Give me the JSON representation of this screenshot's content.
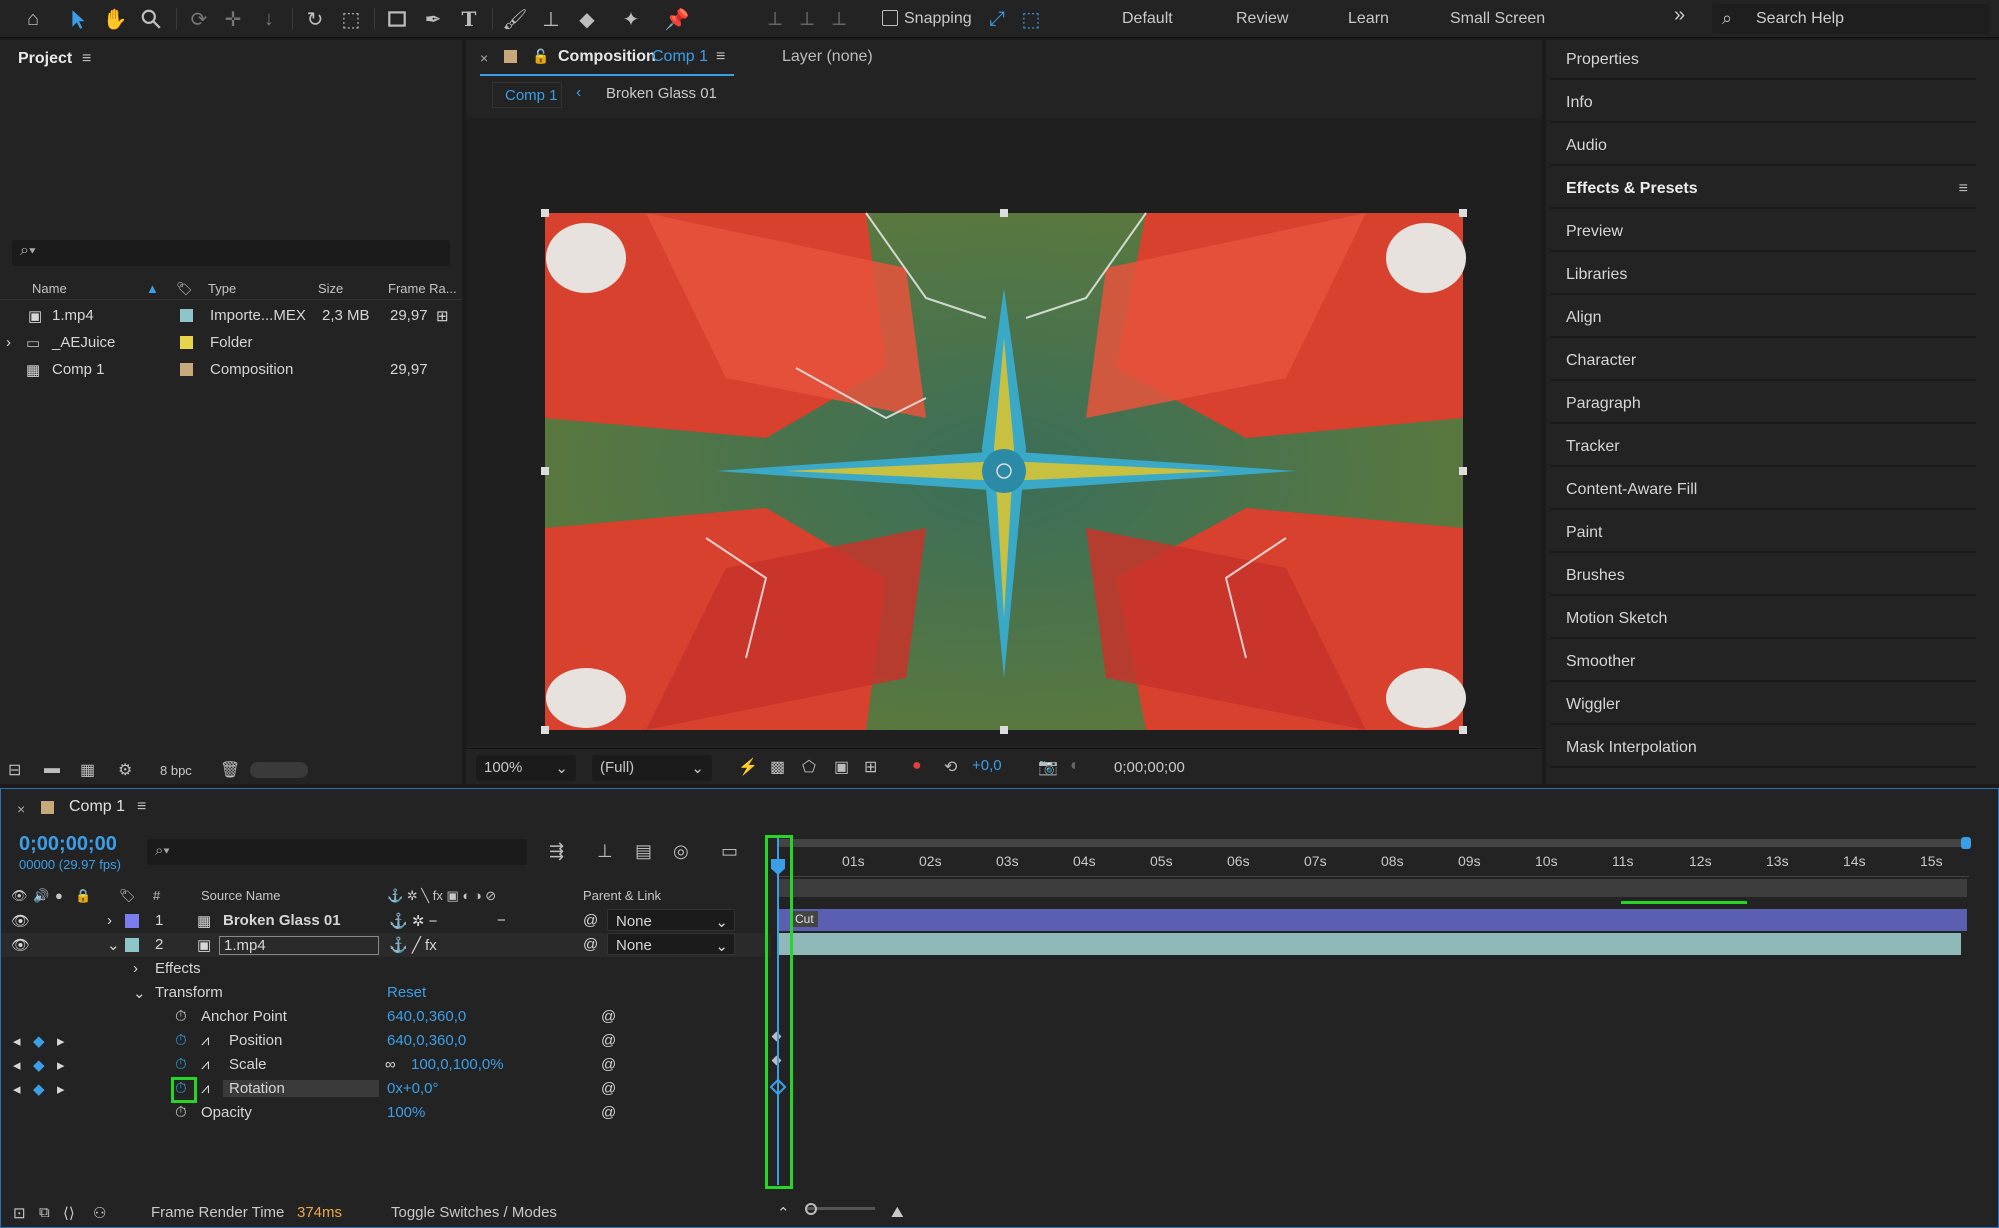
{
  "toolbar": {
    "snapping_label": "Snapping",
    "workspaces": [
      "Default",
      "Review",
      "Learn",
      "Small Screen"
    ],
    "overflow": "»",
    "search_placeholder": "Search Help"
  },
  "project": {
    "title": "Project",
    "columns": {
      "name": "Name",
      "type": "Type",
      "size": "Size",
      "frame_rate": "Frame Ra..."
    },
    "items": [
      {
        "name": "1.mp4",
        "type": "Importe...MEX",
        "size": "2,3 MB",
        "frame_rate": "29,97",
        "color": "#8ec5c9"
      },
      {
        "name": "_AEJuice",
        "type": "Folder",
        "size": "",
        "frame_rate": "",
        "color": "#e8d44a"
      },
      {
        "name": "Comp 1",
        "type": "Composition",
        "size": "",
        "frame_rate": "29,97",
        "color": "#c9a97c"
      }
    ],
    "bit_depth": "8 bpc"
  },
  "composition": {
    "tab_label": "Composition",
    "tab_name": "Comp 1",
    "layer_label": "Layer (none)",
    "breadcrumb_current": "Comp 1",
    "breadcrumb_next": "Broken Glass 01",
    "zoom": "100%",
    "resolution": "(Full)",
    "exposure": "+0,0",
    "timecode": "0;00;00;00"
  },
  "right_panel": {
    "items": [
      "Properties",
      "Info",
      "Audio",
      "Effects & Presets",
      "Preview",
      "Libraries",
      "Align",
      "Character",
      "Paragraph",
      "Tracker",
      "Content-Aware Fill",
      "Paint",
      "Brushes",
      "Motion Sketch",
      "Smoother",
      "Wiggler",
      "Mask Interpolation"
    ],
    "active": "Effects & Presets"
  },
  "timeline": {
    "comp_name": "Comp 1",
    "timecode": "0;00;00;00",
    "fps_label": "00000 (29.97 fps)",
    "columns": {
      "num": "#",
      "source_name": "Source Name",
      "parent": "Parent & Link"
    },
    "layers": [
      {
        "num": "1",
        "name": "Broken Glass 01",
        "parent": "None",
        "color": "#7d7df0"
      },
      {
        "num": "2",
        "name": "1.mp4",
        "parent": "None",
        "color": "#8ec5c9"
      }
    ],
    "properties": {
      "effects": "Effects",
      "transform": "Transform",
      "reset": "Reset",
      "anchor_point": {
        "label": "Anchor Point",
        "value": "640,0,360,0"
      },
      "position": {
        "label": "Position",
        "value": "640,0,360,0"
      },
      "scale": {
        "label": "Scale",
        "value": "100,0,100,0%"
      },
      "rotation": {
        "label": "Rotation",
        "value": "0x+0,0°"
      },
      "opacity": {
        "label": "Opacity",
        "value": "100%"
      }
    },
    "ruler": [
      "01s",
      "02s",
      "03s",
      "04s",
      "05s",
      "06s",
      "07s",
      "08s",
      "09s",
      "10s",
      "11s",
      "12s",
      "13s",
      "14s",
      "15s"
    ],
    "clip_label": "Cut",
    "footer": {
      "render_label": "Frame Render Time",
      "render_value": "374ms",
      "toggle": "Toggle Switches / Modes"
    }
  }
}
